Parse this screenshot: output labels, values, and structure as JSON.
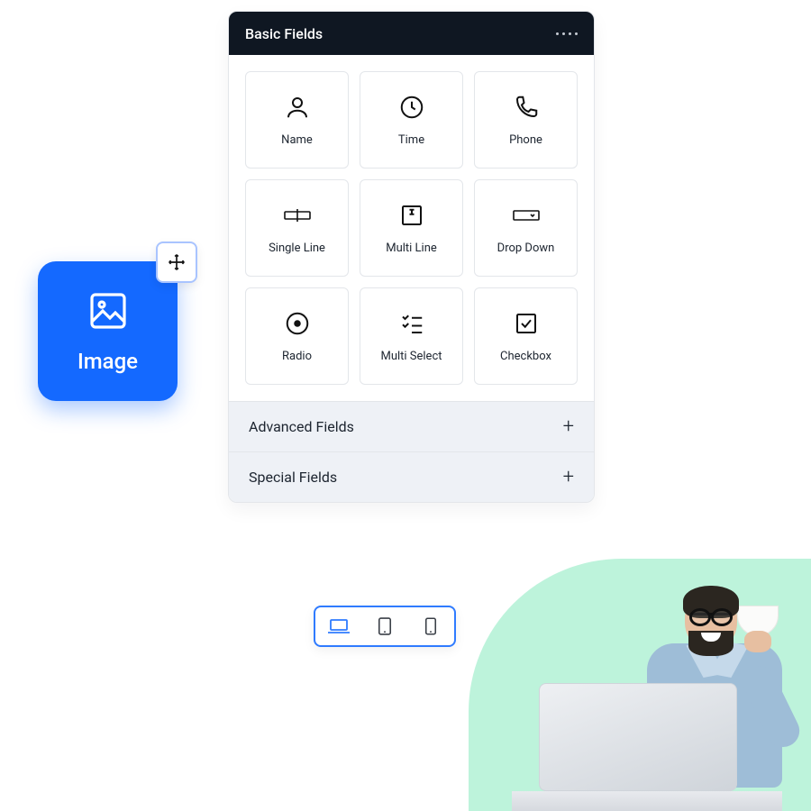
{
  "panel": {
    "header_title": "Basic Fields",
    "fields": [
      {
        "label": "Name"
      },
      {
        "label": "Time"
      },
      {
        "label": "Phone"
      },
      {
        "label": "Single Line"
      },
      {
        "label": "Multi Line"
      },
      {
        "label": "Drop Down"
      },
      {
        "label": "Radio"
      },
      {
        "label": "Multi Select"
      },
      {
        "label": "Checkbox"
      }
    ],
    "accordion": [
      {
        "label": "Advanced Fields"
      },
      {
        "label": "Special Fields"
      }
    ]
  },
  "drag_tile": {
    "label": "Image"
  },
  "device_switcher": {
    "items": [
      "laptop",
      "tablet",
      "phone"
    ],
    "active_index": 0
  },
  "colors": {
    "primary": "#1469ff",
    "header_bg": "#0f1722",
    "photo_bg": "#bdf3db"
  }
}
